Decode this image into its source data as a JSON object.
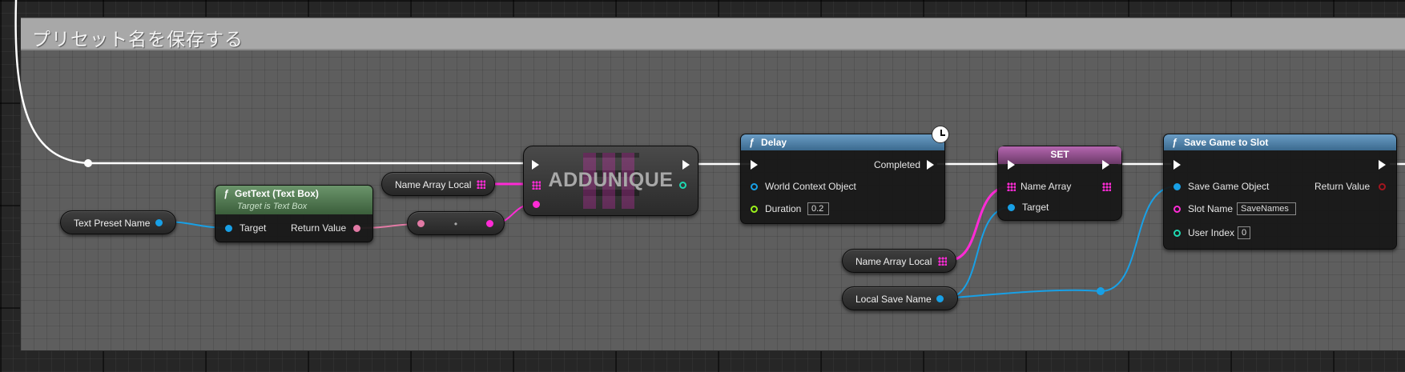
{
  "comment": {
    "title": "プリセット名を保存する"
  },
  "colors": {
    "exec_wire": "#ffffff",
    "string_pin": "#ff4fd0",
    "text_pin": "#e27aa5",
    "object_pin": "#18a0e6",
    "int_pin": "#1ed9b2",
    "float_pin": "#9bf21b",
    "function_header_green": "#4e7c4e",
    "function_header_blue": "#4a7fa6",
    "set_header": "#8a4b86"
  },
  "nodes": {
    "text_preset_name": {
      "label": "Text Preset Name"
    },
    "gettext": {
      "title": "GetText (Text Box)",
      "subtitle": "Target is Text Box",
      "target": "Target",
      "return": "Return Value",
      "icon": "function-icon"
    },
    "name_array_local_1": {
      "label": "Name Array Local"
    },
    "conversion": {
      "label": "•"
    },
    "addunique": {
      "title": "ADDUNIQUE"
    },
    "delay": {
      "title": "Delay",
      "world": "World Context Object",
      "duration_label": "Duration",
      "duration_value": "0.2",
      "completed": "Completed",
      "icon": "clock-icon"
    },
    "set": {
      "title": "SET",
      "name_array": "Name Array",
      "target": "Target"
    },
    "name_array_local_2": {
      "label": "Name Array Local"
    },
    "local_save_name": {
      "label": "Local Save Name"
    },
    "save_game": {
      "title": "Save Game to Slot",
      "save_obj": "Save Game Object",
      "slot_name": "Slot Name",
      "slot_value": "SaveNames",
      "user_index": "User Index",
      "user_value": "0",
      "return": "Return Value"
    }
  }
}
